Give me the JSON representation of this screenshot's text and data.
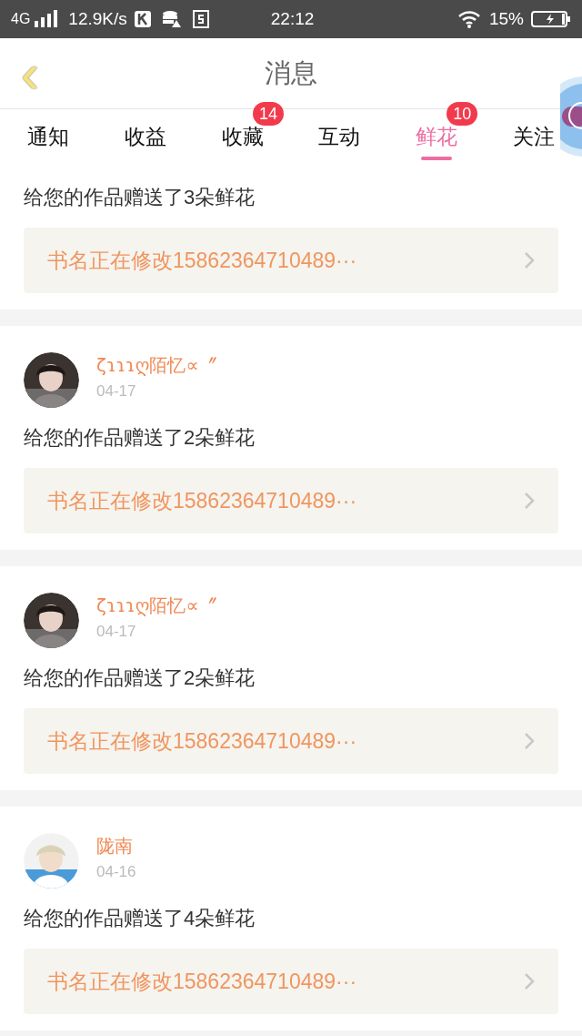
{
  "status_bar": {
    "network": "4G",
    "speed": "12.9K/s",
    "time": "22:12",
    "battery": "15%"
  },
  "header": {
    "back": "‹",
    "title": "消息"
  },
  "tabs": [
    {
      "label": "通知",
      "selected": false
    },
    {
      "label": "收益",
      "selected": false
    },
    {
      "label": "收藏",
      "selected": false,
      "badge": "14"
    },
    {
      "label": "互动",
      "selected": false
    },
    {
      "label": "鲜花",
      "selected": true,
      "badge": "10"
    },
    {
      "label": "关注",
      "selected": false
    }
  ],
  "messages": [
    {
      "text": "给您的作品赠送了3朵鲜花",
      "book": "书名正在修改15862364710489···"
    },
    {
      "user": {
        "name": "ζɿɿɿღ陌忆∝〞",
        "date": "04-17"
      },
      "text": "给您的作品赠送了2朵鲜花",
      "book": "书名正在修改15862364710489···"
    },
    {
      "user": {
        "name": "ζɿɿɿღ陌忆∝〞",
        "date": "04-17"
      },
      "text": "给您的作品赠送了2朵鲜花",
      "book": "书名正在修改15862364710489···"
    },
    {
      "user": {
        "name": "陇南",
        "date": "04-16"
      },
      "text": "给您的作品赠送了4朵鲜花",
      "book": "书名正在修改15862364710489···"
    }
  ]
}
